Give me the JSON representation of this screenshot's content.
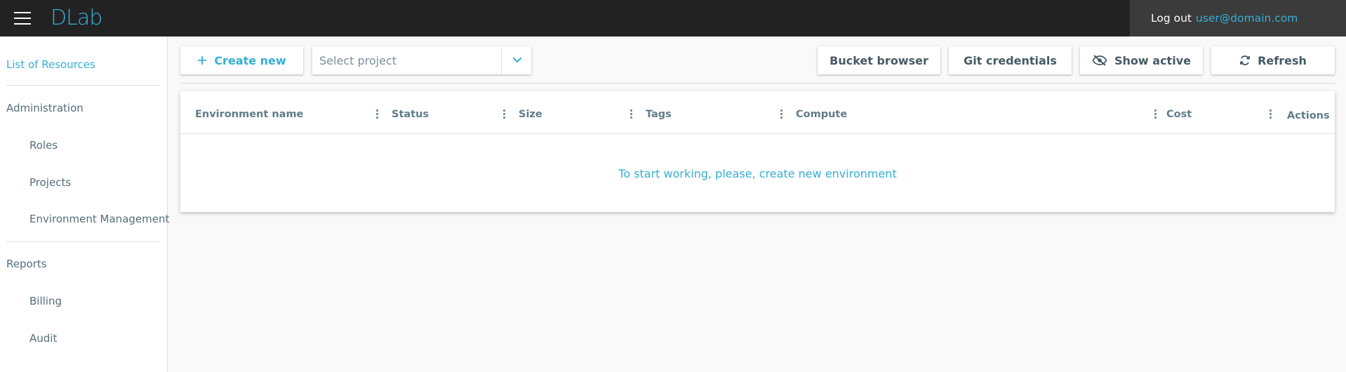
{
  "app": {
    "logo": "DLab"
  },
  "header": {
    "logout_label": "Log out",
    "user_email": "user@domain.com"
  },
  "sidebar": {
    "list_of_resources": "List of Resources",
    "administration": "Administration",
    "roles": "Roles",
    "projects": "Projects",
    "environment_management": "Environment Management",
    "reports": "Reports",
    "billing": "Billing",
    "audit": "Audit"
  },
  "toolbar": {
    "create_new": "Create new",
    "project_select_placeholder": "Select project",
    "bucket_browser": "Bucket browser",
    "git_credentials": "Git credentials",
    "show_active": "Show active",
    "refresh": "Refresh"
  },
  "table": {
    "columns": [
      "Environment name",
      "Status",
      "Size",
      "Tags",
      "Compute",
      "Cost",
      "Actions"
    ],
    "empty_message": "To start working, please, create new environment"
  },
  "colors": {
    "accent": "#35afd5",
    "topbar": "#222222",
    "user_box": "#3b3b3b"
  },
  "icons": [
    "menu-icon",
    "plus-icon",
    "chevron-down-icon",
    "eye-off-icon",
    "refresh-icon",
    "kebab-icon"
  ]
}
